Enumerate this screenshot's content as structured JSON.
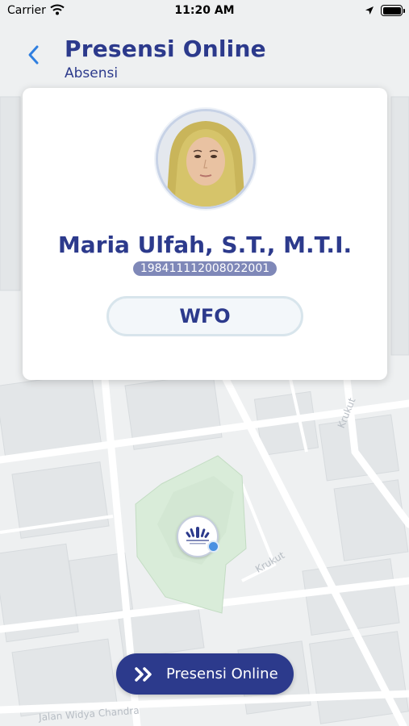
{
  "status_bar": {
    "carrier": "Carrier",
    "time": "11:20 AM"
  },
  "header": {
    "title": "Presensi Online",
    "subtitle": "Absensi"
  },
  "profile": {
    "name": "Maria Ulfah, S.T., M.T.I.",
    "employee_id": "198411112008022001",
    "work_mode": "WFO"
  },
  "map": {
    "street_labels": [
      "Krukut",
      "Krukut",
      "Jalan Widya Chandra"
    ]
  },
  "actions": {
    "presensi_label": "Presensi Online"
  },
  "colors": {
    "primary": "#2c3a8c",
    "id_badge": "#7f88b8",
    "location_dot": "#4a90e2",
    "office_area": "#d9ecd9"
  }
}
